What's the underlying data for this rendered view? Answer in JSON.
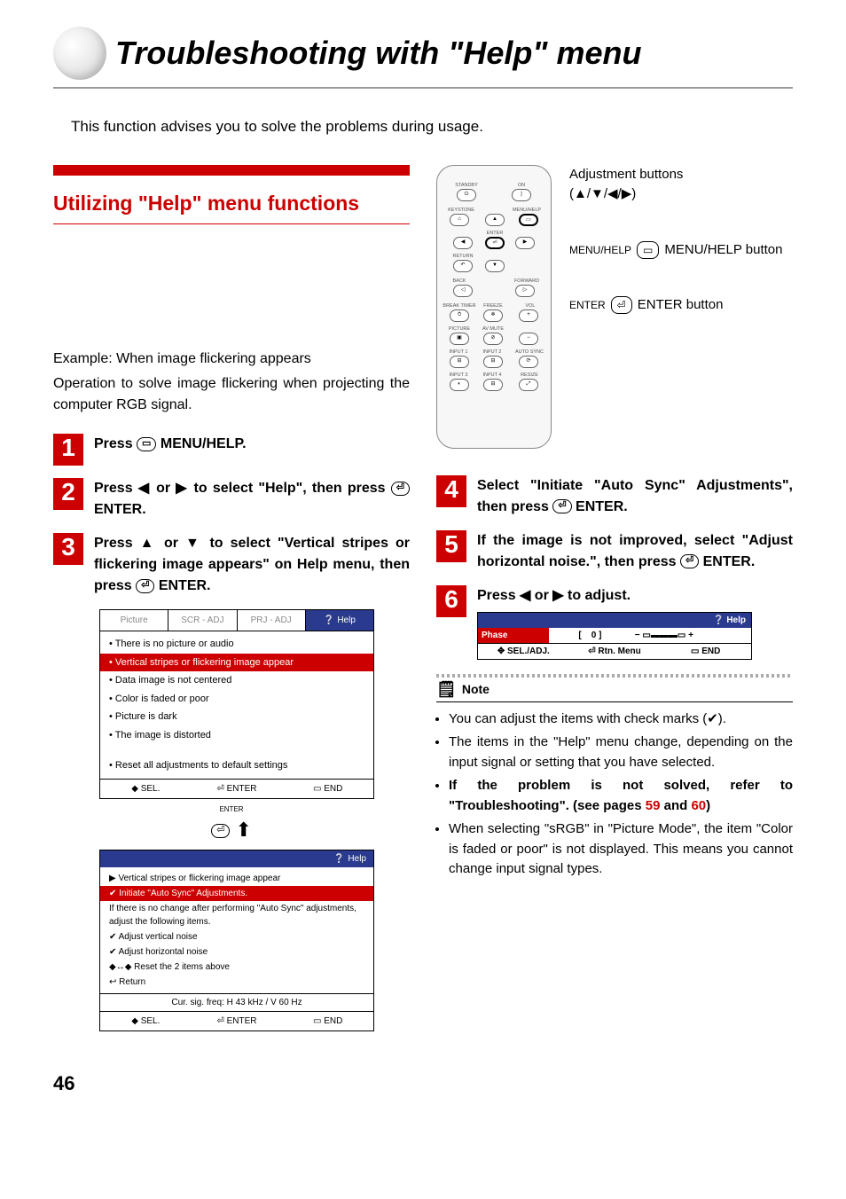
{
  "page_number": "46",
  "title": "Troubleshooting with \"Help\" menu",
  "intro": "This function advises you to solve the problems during usage.",
  "subhead": "Utilizing \"Help\" menu functions",
  "example_label": "Example: When image flickering appears",
  "example_text": "Operation to solve image flickering when projecting the computer RGB signal.",
  "steps": {
    "s1_a": "Press ",
    "s1_b": " MENU/HELP.",
    "s2_a": "Press ◀ or ▶ to select \"Help\", then press ",
    "s2_b": "ENTER.",
    "s3_a": "Press ▲ or ▼ to select \"Vertical stripes or flickering image appears\" on Help menu, then press ",
    "s3_b": "ENTER.",
    "s4_a": "Select \"Initiate \"Auto Sync\" Adjustments\", then press ",
    "s4_b": "ENTER.",
    "s5_a": "If the image is not improved, select \"Adjust horizontal noise.\", then press ",
    "s5_b": "ENTER.",
    "s6": "Press ◀ or ▶ to adjust."
  },
  "osd1": {
    "tabs": [
      "Picture",
      "SCR - ADJ",
      "PRJ - ADJ",
      "Help"
    ],
    "items": [
      "• There is no picture or audio",
      "• Vertical stripes or flickering image appear",
      "• Data image is not centered",
      "• Color is faded or poor",
      "• Picture is dark",
      "• The image is distorted",
      "",
      "• Reset all adjustments to default settings"
    ],
    "selected_index": 1,
    "foot": [
      "◆ SEL.",
      "⏎ ENTER",
      "▭ END"
    ]
  },
  "osd_enter_label": "ENTER",
  "osd2": {
    "head_label": "Help",
    "items": [
      "▶ Vertical stripes or flickering image appear",
      "✔ Initiate \"Auto Sync\" Adjustments.",
      "If there is no change after performing \"Auto Sync\" adjustments, adjust the following items.",
      "✔ Adjust vertical noise",
      "✔ Adjust horizontal noise",
      "◆↔◆ Reset the 2 items above",
      "↩ Return"
    ],
    "selected_index": 1,
    "signal": "Cur. sig. freq: H 43 kHz / V 60 Hz",
    "foot": [
      "◆ SEL.",
      "⏎ ENTER",
      "▭ END"
    ]
  },
  "phase": {
    "head": "❔  Help",
    "label": "Phase",
    "value": "0",
    "foot": [
      "✥ SEL./ADJ.",
      "⏎ Rtn. Menu",
      "▭ END"
    ]
  },
  "callouts": {
    "adj": "Adjustment buttons",
    "adj_sym": "(▲/▼/◀/▶)",
    "menu_word": "MENU/HELP",
    "menu": "MENU/HELP button",
    "enter_word": "ENTER",
    "enter": "ENTER button"
  },
  "remote": {
    "standby": "STANDBY",
    "on": "ON",
    "keystone": "KEYSTONE",
    "menuhelp": "MENU/HELP",
    "enter": "ENTER",
    "return": "RETURN",
    "back": "BACK",
    "forward": "FORWARD",
    "breaktimer": "BREAK TIMER",
    "freeze": "FREEZE",
    "vol": "VOL",
    "pmode": "PICTURE MODE",
    "avmute": "AV MUTE",
    "in1": "INPUT 1",
    "in2": "INPUT 2",
    "autosync": "AUTO SYNC",
    "in3": "INPUT 3",
    "in4": "INPUT 4",
    "resize": "RESIZE"
  },
  "note": {
    "head": "Note",
    "items": [
      "You can adjust the items with check marks (✔).",
      "The items in the \"Help\" menu change, depending on the input signal or setting that you have selected.",
      "If the problem is not solved, refer to \"Troubleshooting\". (see pages 59 and 60)",
      "When selecting \"sRGB\" in \"Picture Mode\", the item \"Color is faded or poor\" is not displayed. This means you cannot change input signal types."
    ],
    "bold_index": 2,
    "link_a": "59",
    "link_b": "60"
  }
}
